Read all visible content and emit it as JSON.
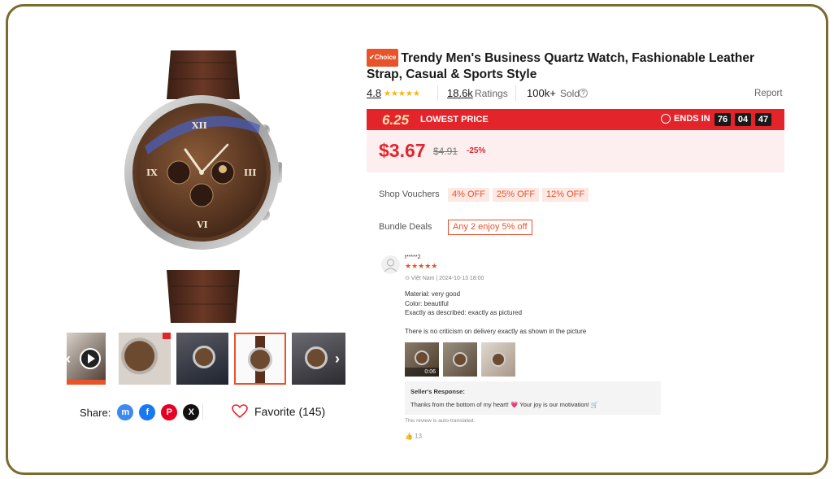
{
  "product": {
    "choice_badge": "✔Choice",
    "title": "Trendy Men's Business Quartz Watch, Fashionable Leather Strap, Casual & Sports Style",
    "rating": "4.8",
    "stars": "★★★★★",
    "ratings_count": "18.6k",
    "ratings_label": "Ratings",
    "sold_count": "100k+",
    "sold_label": "Sold",
    "help_icon": "?",
    "report_label": "Report"
  },
  "promo": {
    "event": "6.25",
    "label": "LOWEST PRICE",
    "ends_label": "ENDS IN",
    "countdown": [
      "76",
      "04",
      "47"
    ]
  },
  "price": {
    "current": "$3.67",
    "original": "$4.91",
    "discount": "-25%"
  },
  "vouchers": {
    "label": "Shop Vouchers",
    "items": [
      "4% OFF",
      "25% OFF",
      "12% OFF"
    ]
  },
  "bundle": {
    "label": "Bundle Deals",
    "offer": "Any 2 enjoy 5% off"
  },
  "review": {
    "name": "t*****2",
    "stars": "★★★★★",
    "meta": "⊙ Việt Nam | 2024-10-13 18:00",
    "lines": [
      "Material: very good",
      "Color: beautiful",
      "Exactly as described: exactly as pictured",
      "There is no criticism on delivery exactly as shown in the picture"
    ],
    "video_duration": "0:06",
    "seller_title": "Seller's Response:",
    "seller_message": "Thanks from the bottom of my heart! 💗 Your joy is our motivation! 🛒",
    "auto_translated": "This review is auto-translated.",
    "likes": "13"
  },
  "share": {
    "label": "Share:"
  },
  "favorite": {
    "label": "Favorite (145)"
  },
  "colors": {
    "accent": "#e8532a",
    "promo_red": "#e3242b",
    "price_bg": "#fdeff0",
    "star_gold": "#fdb400",
    "frame": "#7a6a2e"
  },
  "thumbnails": {
    "count": 5,
    "selected_index": 3
  }
}
